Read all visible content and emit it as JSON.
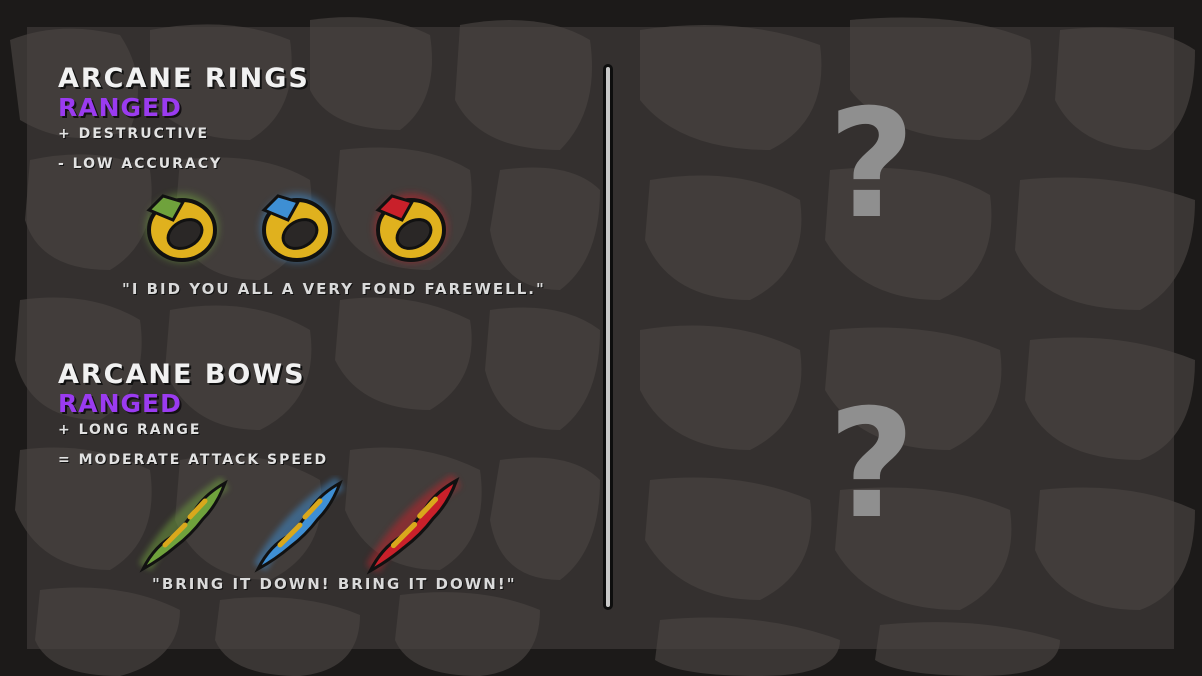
{
  "colors": {
    "category_accent": "#9a3bf0",
    "green_gem": "#6fa23c",
    "blue_gem": "#3e8fd4",
    "red_gem": "#c9202a",
    "gold": "#e0b11e"
  },
  "weapons": [
    {
      "title": "Arcane Rings",
      "category": "Ranged",
      "pro": "+ Destructive",
      "con": "- Low Accuracy",
      "quote": "\"I bid you all a very fond farewell.\"",
      "variants": [
        "green-ring-icon",
        "blue-ring-icon",
        "red-ring-icon"
      ]
    },
    {
      "title": "Arcane Bows",
      "category": "Ranged",
      "pro": "+ Long Range",
      "con": "= Moderate Attack Speed",
      "quote": "\"Bring it down! Bring it down!\"",
      "variants": [
        "green-bow-icon",
        "blue-bow-icon",
        "red-bow-icon"
      ]
    }
  ],
  "locked": [
    {
      "symbol": "?",
      "icon": "question-mark-icon"
    },
    {
      "symbol": "?",
      "icon": "question-mark-icon"
    }
  ]
}
